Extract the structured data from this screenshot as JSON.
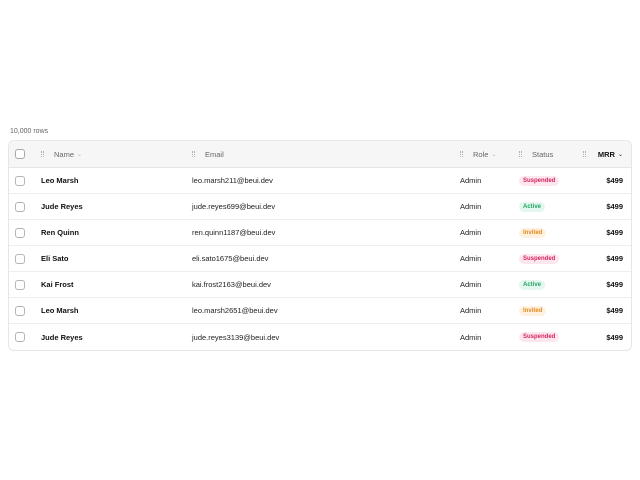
{
  "table": {
    "row_count_label": "10,000 rows",
    "columns": {
      "name": "Name",
      "email": "Email",
      "role": "Role",
      "status": "Status",
      "mrr": "MRR"
    },
    "sorted_column": "mrr",
    "sort_direction": "descending",
    "rows": [
      {
        "name": "Leo Marsh",
        "email": "leo.marsh211@beui.dev",
        "role": "Admin",
        "status": "Suspended",
        "status_key": "suspended",
        "mrr": "$499"
      },
      {
        "name": "Jude Reyes",
        "email": "jude.reyes699@beui.dev",
        "role": "Admin",
        "status": "Active",
        "status_key": "active",
        "mrr": "$499"
      },
      {
        "name": "Ren Quinn",
        "email": "ren.quinn1187@beui.dev",
        "role": "Admin",
        "status": "Invited",
        "status_key": "invited",
        "mrr": "$499"
      },
      {
        "name": "Eli Sato",
        "email": "eli.sato1675@beui.dev",
        "role": "Admin",
        "status": "Suspended",
        "status_key": "suspended",
        "mrr": "$499"
      },
      {
        "name": "Kai Frost",
        "email": "kai.frost2163@beui.dev",
        "role": "Admin",
        "status": "Active",
        "status_key": "active",
        "mrr": "$499"
      },
      {
        "name": "Leo Marsh",
        "email": "leo.marsh2651@beui.dev",
        "role": "Admin",
        "status": "Invited",
        "status_key": "invited",
        "mrr": "$499"
      },
      {
        "name": "Jude Reyes",
        "email": "jude.reyes3139@beui.dev",
        "role": "Admin",
        "status": "Suspended",
        "status_key": "suspended",
        "mrr": "$499"
      }
    ]
  },
  "colors": {
    "suspended": "#d6245d",
    "active": "#20a565",
    "invited": "#e38a1c"
  }
}
